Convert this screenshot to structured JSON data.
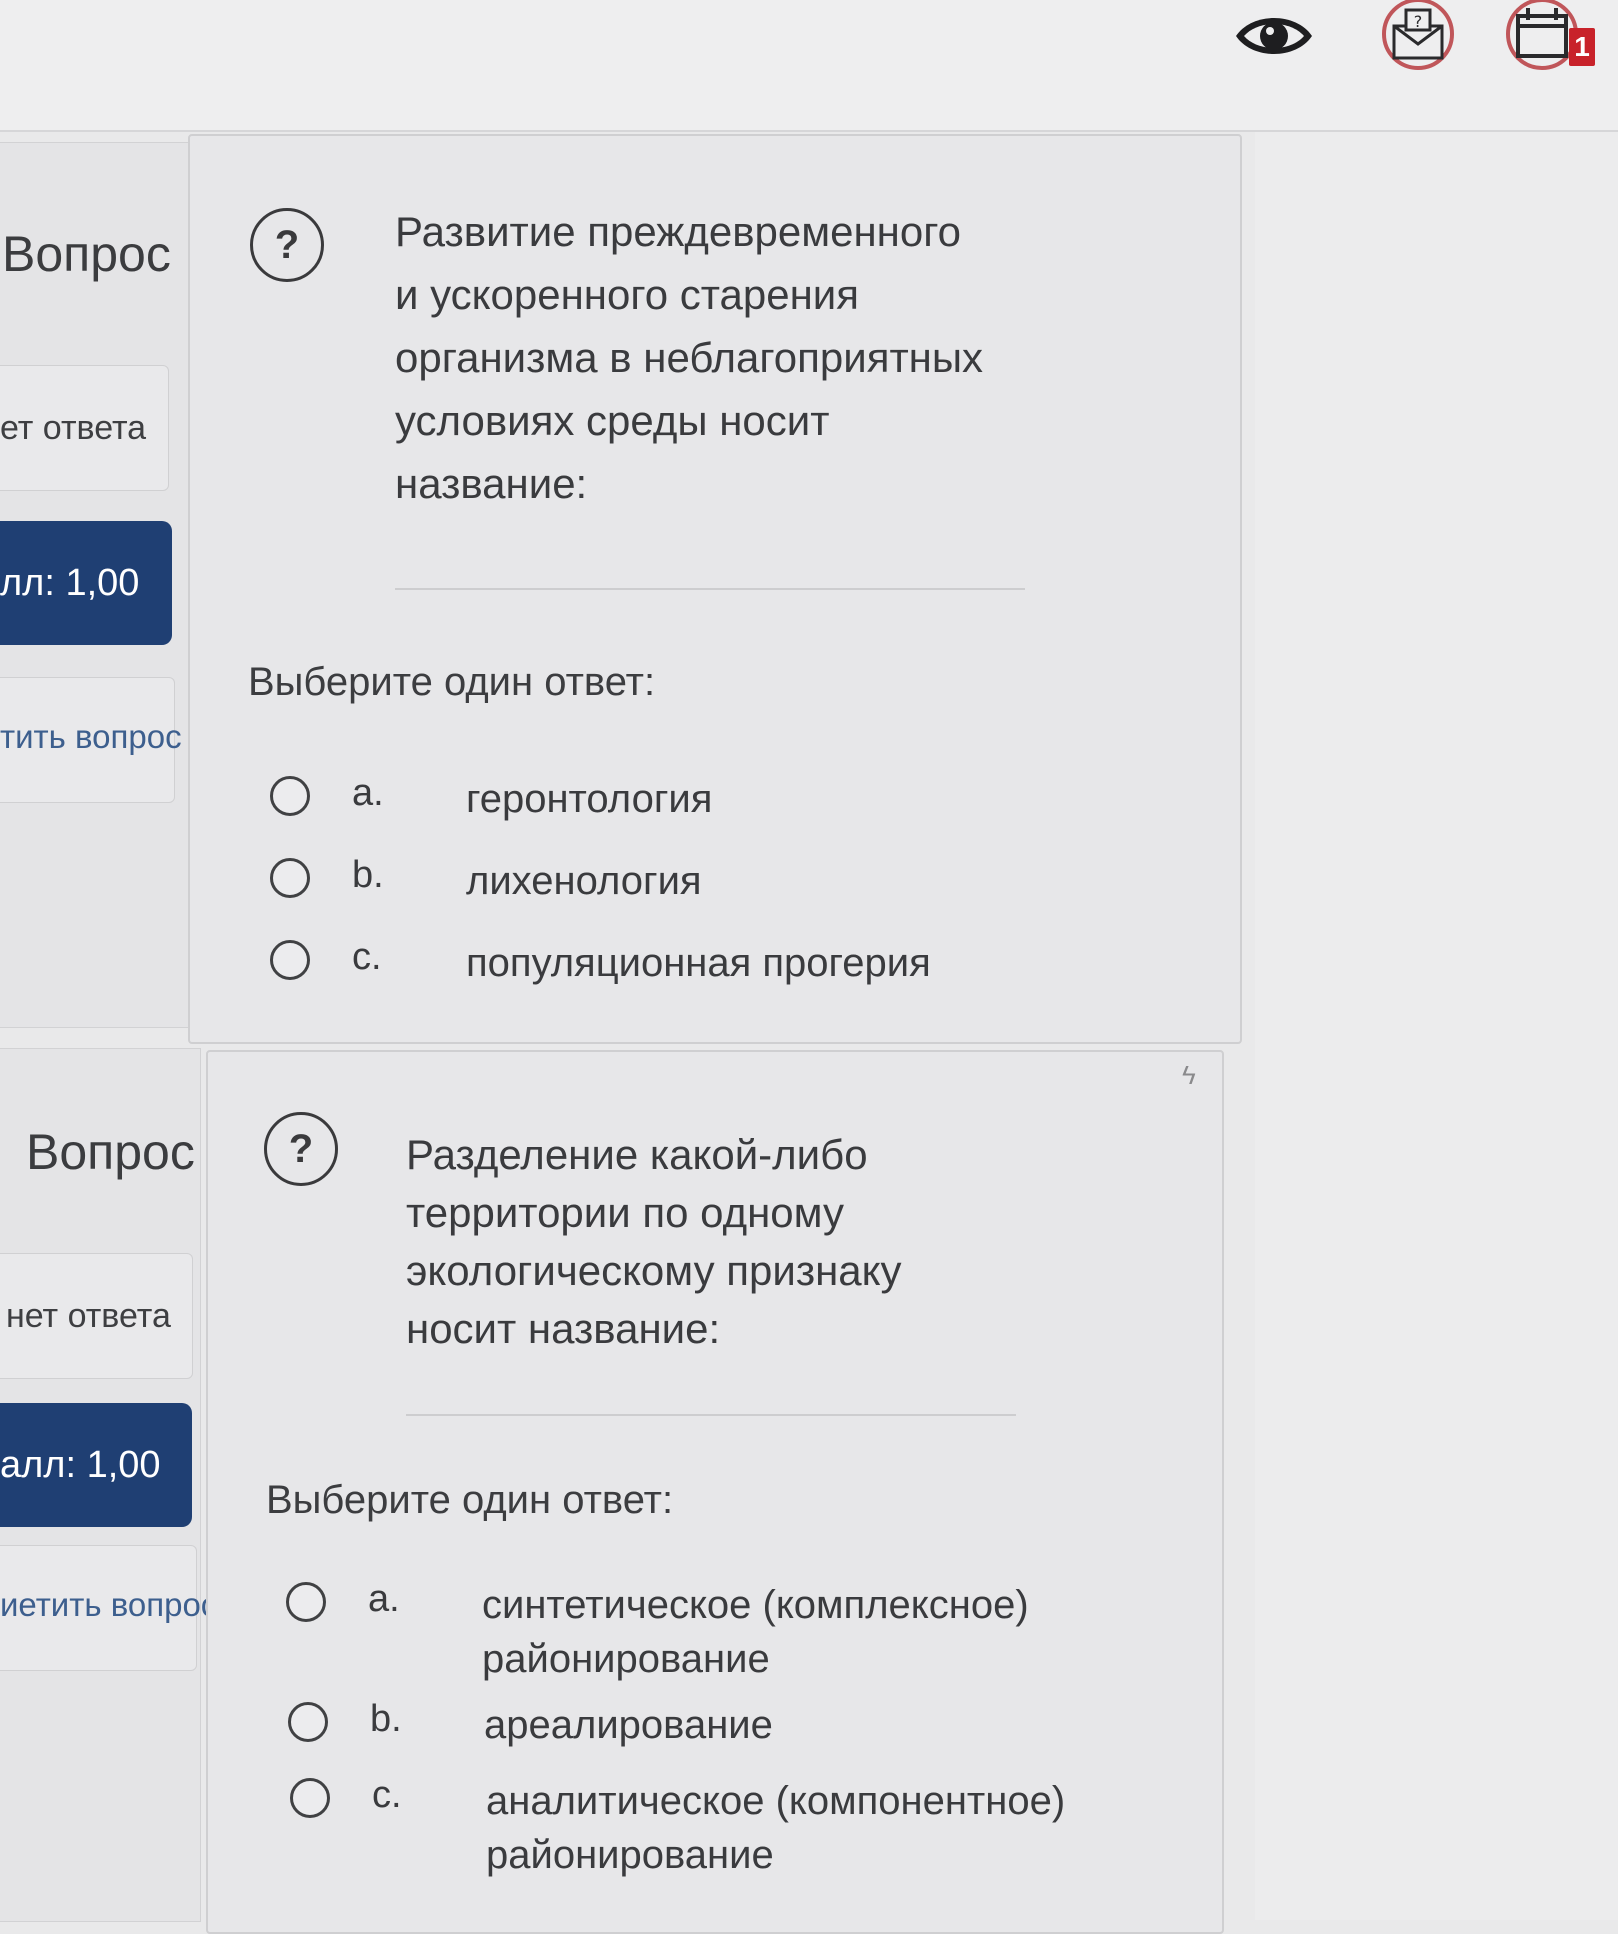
{
  "header": {
    "icons": [
      "eye-icon",
      "message-icon",
      "calendar-icon"
    ],
    "calendar_badge": "1",
    "colors": {
      "badge": "#c8222a",
      "icon_ring": "#c0565a"
    }
  },
  "questions": [
    {
      "info": {
        "title": "Вопрос",
        "state": "ет ответа",
        "grade": "лл: 1,00",
        "flag": "тить вопрос"
      },
      "help_icon": "?",
      "text": "Развитие преждевременного\nи ускоренного старения\nорганизма в неблагоприятных\nусловиях среды носит\nназвание:",
      "prompt": "Выберите один ответ:",
      "options": [
        {
          "letter": "a.",
          "text": "геронтология"
        },
        {
          "letter": "b.",
          "text": "лихенология"
        },
        {
          "letter": "c.",
          "text": "популяционная прогерия"
        }
      ]
    },
    {
      "info": {
        "title": "Вопрос",
        "state": "нет ответа",
        "grade": "алл: 1,00",
        "flag": "иетить вопрос"
      },
      "help_icon": "?",
      "text": "Разделение какой-либо\nтерритории по одному\nэкологическому признаку\nносит название:",
      "prompt": "Выберите один ответ:",
      "options": [
        {
          "letter": "a.",
          "text": "синтетическое (комплексное)\nрайонирование"
        },
        {
          "letter": "b.",
          "text": "ареалирование"
        },
        {
          "letter": "c.",
          "text": "аналитическое (компонентное)\nрайонирование"
        }
      ]
    }
  ],
  "colors": {
    "grade_box": "#1f3f73",
    "flag_link": "#3d5f8e"
  }
}
